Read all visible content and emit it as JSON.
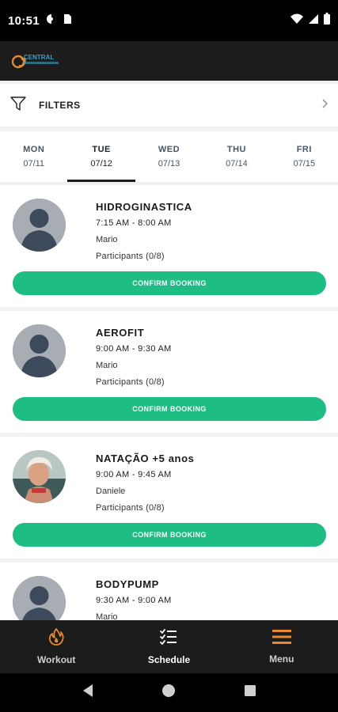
{
  "status": {
    "time": "10:51"
  },
  "filters": {
    "label": "FILTERS"
  },
  "days": [
    {
      "name": "MON",
      "date": "07/11"
    },
    {
      "name": "TUE",
      "date": "07/12"
    },
    {
      "name": "WED",
      "date": "07/13"
    },
    {
      "name": "THU",
      "date": "07/14"
    },
    {
      "name": "FRI",
      "date": "07/15"
    }
  ],
  "active_day": "TUE",
  "classes": [
    {
      "title": "HIDROGINASTICA",
      "time": "7:15 AM - 8:00 AM",
      "coach": "Mario",
      "participants": "Participants (0/8)",
      "button": "CONFIRM BOOKING",
      "avatar": "placeholder"
    },
    {
      "title": "AEROFIT",
      "time": "9:00 AM - 9:30 AM",
      "coach": "Mario",
      "participants": "Participants (0/8)",
      "button": "CONFIRM BOOKING",
      "avatar": "placeholder"
    },
    {
      "title": "NATAÇÃO +5 anos",
      "time": "9:00 AM - 9:45 AM",
      "coach": "Daniele",
      "participants": "Participants (0/8)",
      "button": "CONFIRM BOOKING",
      "avatar": "photo"
    },
    {
      "title": "BODYPUMP",
      "time": "9:30 AM - 9:00 AM",
      "coach": "Mario",
      "participants": "",
      "button": "",
      "avatar": "placeholder"
    }
  ],
  "tabs": [
    {
      "label": "Workout",
      "icon": "flame-icon"
    },
    {
      "label": "Schedule",
      "icon": "checklist-icon"
    },
    {
      "label": "Menu",
      "icon": "hamburger-icon"
    }
  ],
  "active_tab": "Schedule",
  "colors": {
    "accent_orange": "#e8892b",
    "confirm_green": "#1dbd84",
    "bar_dark": "#1c1c1c"
  }
}
